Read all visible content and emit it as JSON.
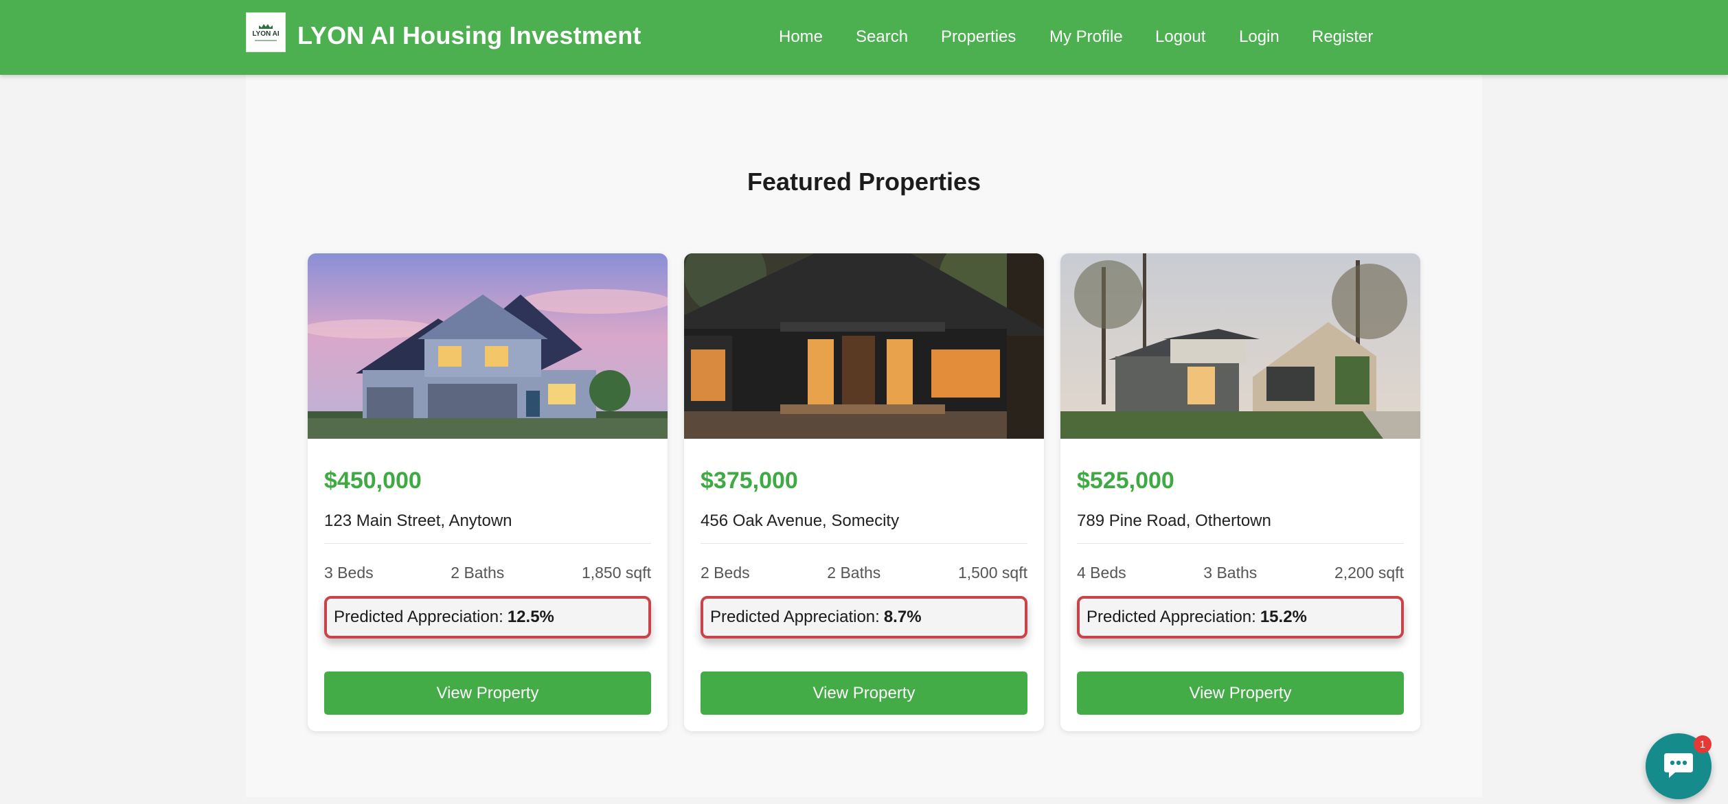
{
  "header": {
    "logo_text": "LYON AI",
    "brand": "LYON AI Housing Investment",
    "nav": [
      {
        "label": "Home",
        "id": "home"
      },
      {
        "label": "Search",
        "id": "search"
      },
      {
        "label": "Properties",
        "id": "properties"
      },
      {
        "label": "My Profile",
        "id": "my-profile"
      },
      {
        "label": "Logout",
        "id": "logout"
      },
      {
        "label": "Login",
        "id": "login"
      },
      {
        "label": "Register",
        "id": "register"
      }
    ]
  },
  "featured": {
    "title": "Featured Properties",
    "appreciation_label": "Predicted Appreciation:",
    "button_label": "View Property",
    "properties": [
      {
        "price": "$450,000",
        "address": "123 Main Street, Anytown",
        "beds": "3 Beds",
        "baths": "2 Baths",
        "sqft": "1,850 sqft",
        "appreciation": "12.5%",
        "image": "two-story blue house with garage at dusk"
      },
      {
        "price": "$375,000",
        "address": "456 Oak Avenue, Somecity",
        "beds": "2 Beds",
        "baths": "2 Baths",
        "sqft": "1,500 sqft",
        "appreciation": "8.7%",
        "image": "dark single-story modern home with lit windows"
      },
      {
        "price": "$525,000",
        "address": "789 Pine Road, Othertown",
        "beds": "4 Beds",
        "baths": "3 Baths",
        "sqft": "2,200 sqft",
        "appreciation": "15.2%",
        "image": "modern gray two-story house with trees"
      }
    ]
  },
  "chat": {
    "icon": "chat-icon",
    "badge_count": "1"
  },
  "colors": {
    "brand_green": "#4caf50",
    "price_green": "#3faa44",
    "highlight_red": "#c9444a",
    "chat_teal": "#168b8b"
  }
}
